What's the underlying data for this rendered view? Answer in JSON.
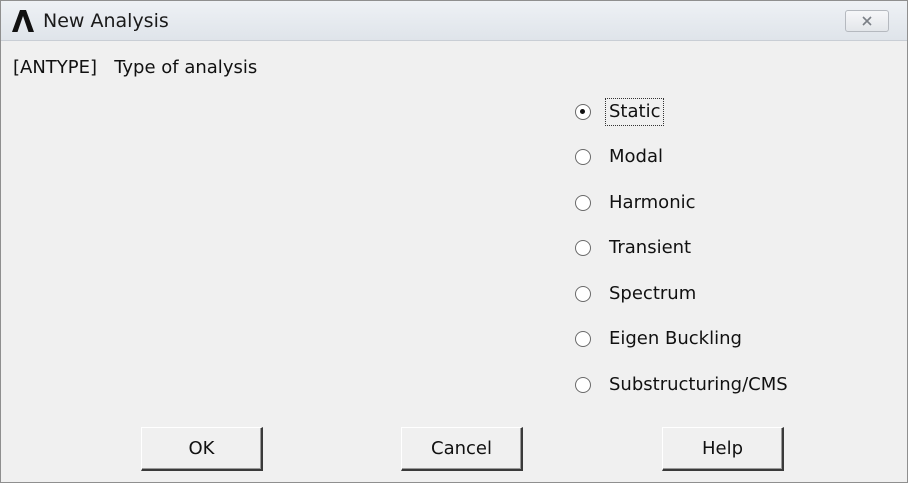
{
  "window": {
    "title": "New Analysis",
    "app_icon": "ansys-logo-icon",
    "close_icon": "close-icon"
  },
  "header": {
    "label": "[ANTYPE]   Type of analysis"
  },
  "analysis_types": [
    {
      "label": "Static",
      "checked": true
    },
    {
      "label": "Modal",
      "checked": false
    },
    {
      "label": "Harmonic",
      "checked": false
    },
    {
      "label": "Transient",
      "checked": false
    },
    {
      "label": "Spectrum",
      "checked": false
    },
    {
      "label": "Eigen Buckling",
      "checked": false
    },
    {
      "label": "Substructuring/CMS",
      "checked": false
    }
  ],
  "buttons": {
    "ok": "OK",
    "cancel": "Cancel",
    "help": "Help"
  },
  "colors": {
    "dialog_background": "#f0f0f0",
    "titlebar_background": "#e6eaef"
  }
}
